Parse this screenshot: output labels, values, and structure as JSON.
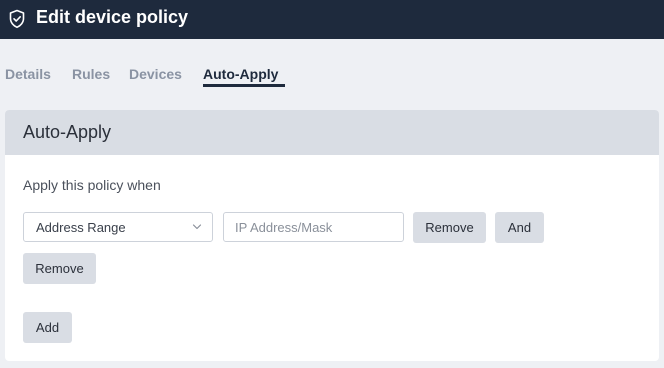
{
  "header": {
    "title": "Edit device policy",
    "icon": "shield-check-icon",
    "background": "#1e2a3d"
  },
  "tabs": [
    {
      "label": "Details",
      "active": false
    },
    {
      "label": "Rules",
      "active": false
    },
    {
      "label": "Devices",
      "active": false
    },
    {
      "label": "Auto-Apply",
      "active": true
    }
  ],
  "card": {
    "title": "Auto-Apply",
    "description": "Apply this policy when",
    "condition": {
      "select_value": "Address Range",
      "input_value": "",
      "input_placeholder": "IP Address/Mask",
      "remove_label": "Remove",
      "and_label": "And"
    },
    "group_remove_label": "Remove",
    "add_label": "Add"
  }
}
